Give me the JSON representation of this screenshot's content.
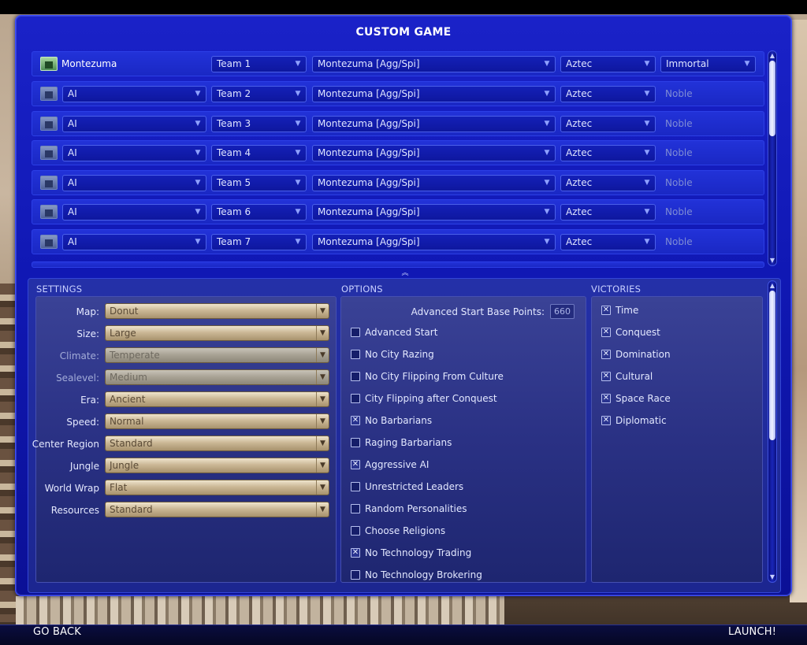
{
  "window": {
    "title": "CUSTOM GAME"
  },
  "players": [
    {
      "type": "Montezuma",
      "human": true,
      "team": "Team 1",
      "leader": "Montezuma [Agg/Spi]",
      "civ": "Aztec",
      "difficulty": "Immortal"
    },
    {
      "type": "AI",
      "human": false,
      "team": "Team 2",
      "leader": "Montezuma [Agg/Spi]",
      "civ": "Aztec",
      "difficulty": "Noble"
    },
    {
      "type": "AI",
      "human": false,
      "team": "Team 3",
      "leader": "Montezuma [Agg/Spi]",
      "civ": "Aztec",
      "difficulty": "Noble"
    },
    {
      "type": "AI",
      "human": false,
      "team": "Team 4",
      "leader": "Montezuma [Agg/Spi]",
      "civ": "Aztec",
      "difficulty": "Noble"
    },
    {
      "type": "AI",
      "human": false,
      "team": "Team 5",
      "leader": "Montezuma [Agg/Spi]",
      "civ": "Aztec",
      "difficulty": "Noble"
    },
    {
      "type": "AI",
      "human": false,
      "team": "Team 6",
      "leader": "Montezuma [Agg/Spi]",
      "civ": "Aztec",
      "difficulty": "Noble"
    },
    {
      "type": "AI",
      "human": false,
      "team": "Team 7",
      "leader": "Montezuma [Agg/Spi]",
      "civ": "Aztec",
      "difficulty": "Noble"
    }
  ],
  "settings": {
    "header": "SETTINGS",
    "rows": [
      {
        "label": "Map:",
        "value": "Donut",
        "disabled": false
      },
      {
        "label": "Size:",
        "value": "Large",
        "disabled": false
      },
      {
        "label": "Climate:",
        "value": "Temperate",
        "disabled": true
      },
      {
        "label": "Sealevel:",
        "value": "Medium",
        "disabled": true
      },
      {
        "label": "Era:",
        "value": "Ancient",
        "disabled": false
      },
      {
        "label": "Speed:",
        "value": "Normal",
        "disabled": false
      },
      {
        "label": "Center Region",
        "value": "Standard",
        "disabled": false
      },
      {
        "label": "Jungle",
        "value": "Jungle",
        "disabled": false
      },
      {
        "label": "World Wrap",
        "value": "Flat",
        "disabled": false
      },
      {
        "label": "Resources",
        "value": "Standard",
        "disabled": false
      }
    ]
  },
  "options": {
    "header": "OPTIONS",
    "points_label": "Advanced Start Base Points:",
    "points_value": "660",
    "items": [
      {
        "label": "Advanced Start",
        "checked": false
      },
      {
        "label": "No City Razing",
        "checked": false
      },
      {
        "label": "No City Flipping From Culture",
        "checked": false
      },
      {
        "label": "City Flipping after Conquest",
        "checked": false
      },
      {
        "label": "No Barbarians",
        "checked": true
      },
      {
        "label": "Raging Barbarians",
        "checked": false
      },
      {
        "label": "Aggressive AI",
        "checked": true
      },
      {
        "label": "Unrestricted Leaders",
        "checked": false
      },
      {
        "label": "Random Personalities",
        "checked": false
      },
      {
        "label": "Choose Religions",
        "checked": false
      },
      {
        "label": "No Technology Trading",
        "checked": true
      },
      {
        "label": "No Technology Brokering",
        "checked": false
      }
    ]
  },
  "victories": {
    "header": "VICTORIES",
    "items": [
      {
        "label": "Time",
        "checked": true
      },
      {
        "label": "Conquest",
        "checked": true
      },
      {
        "label": "Domination",
        "checked": true
      },
      {
        "label": "Cultural",
        "checked": true
      },
      {
        "label": "Space Race",
        "checked": true
      },
      {
        "label": "Diplomatic",
        "checked": true
      }
    ]
  },
  "footer": {
    "back_label": "GO BACK",
    "launch_label": "LAUNCH!"
  },
  "icons": {
    "dropdown": "chevron-down-icon",
    "check": "x-check-icon",
    "player": "player-slot-icon"
  }
}
